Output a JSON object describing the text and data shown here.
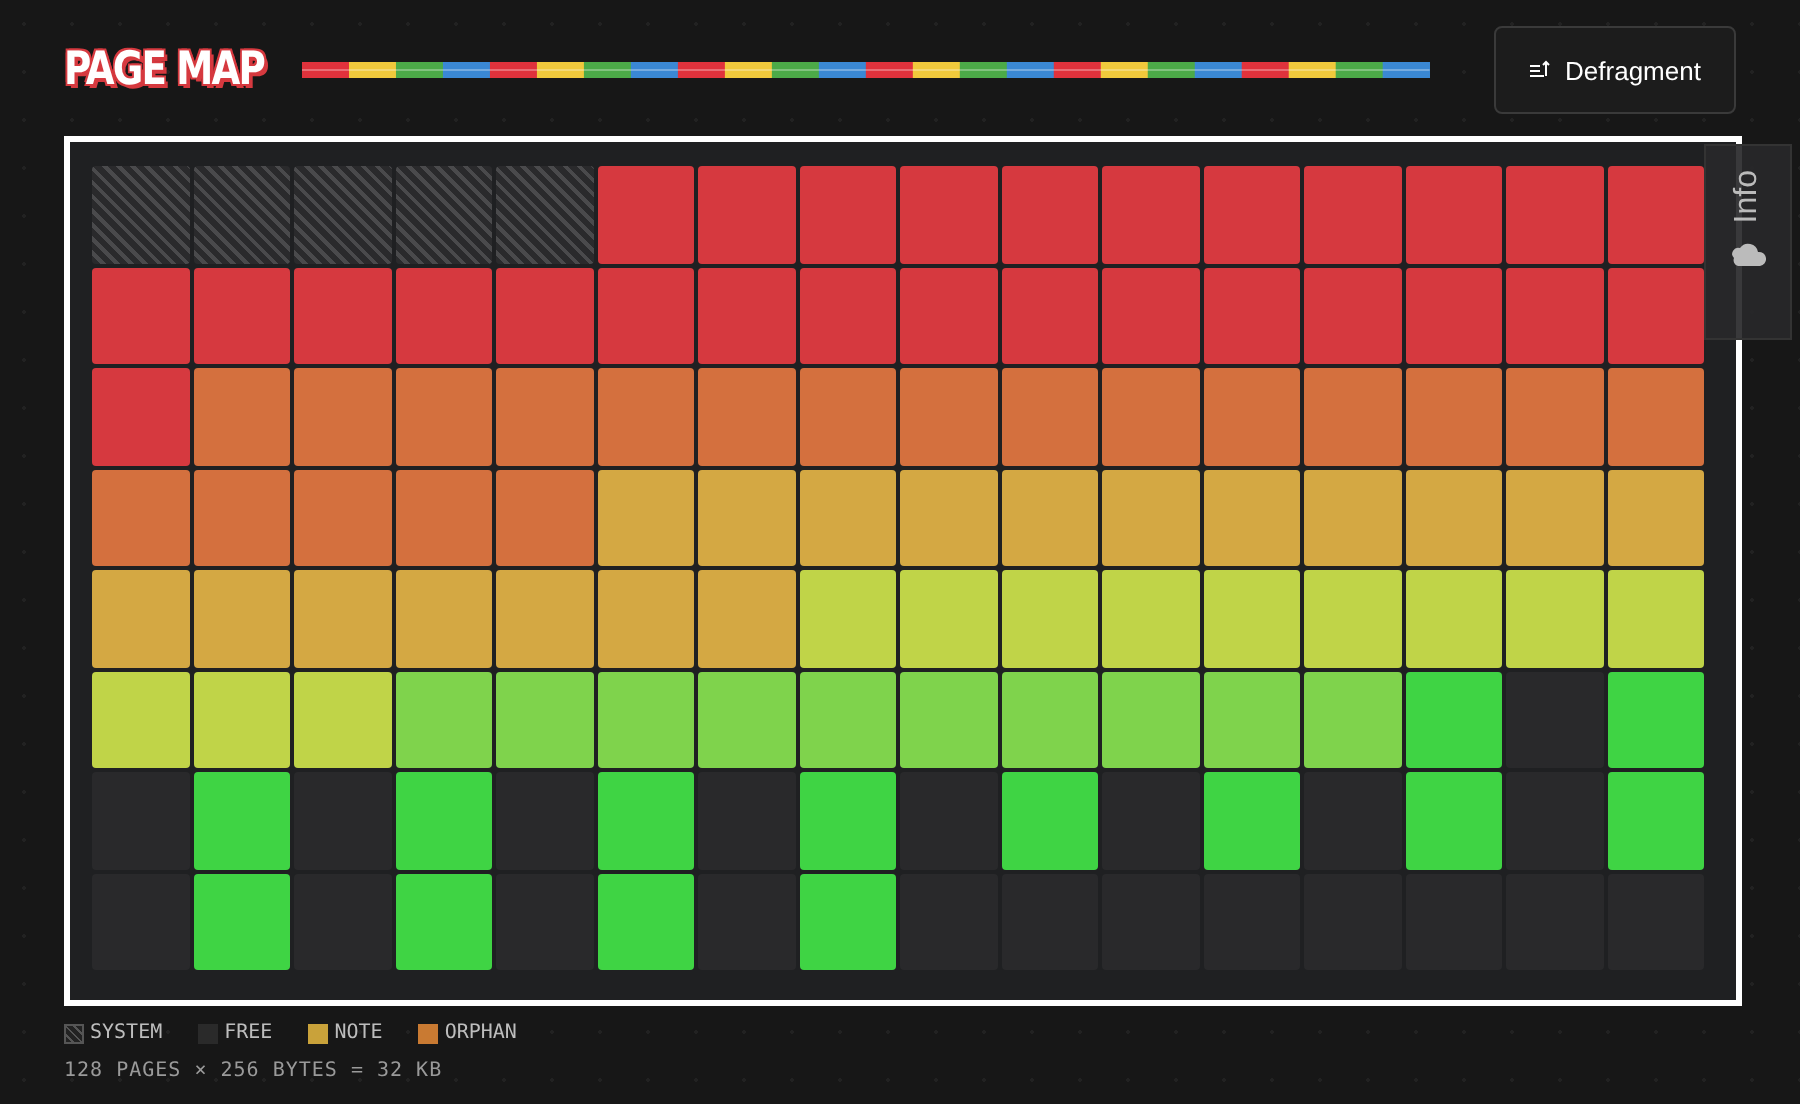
{
  "header": {
    "title": "PAGE MAP",
    "button": "Defragment"
  },
  "side_tab": {
    "label": "Info"
  },
  "pages": [
    {
      "kind": "system"
    },
    {
      "kind": "system"
    },
    {
      "kind": "system"
    },
    {
      "kind": "system"
    },
    {
      "kind": "system"
    },
    {
      "kind": "used",
      "color": "#d6393f"
    },
    {
      "kind": "used",
      "color": "#d6393f"
    },
    {
      "kind": "used",
      "color": "#d6393f"
    },
    {
      "kind": "used",
      "color": "#d6393f"
    },
    {
      "kind": "used",
      "color": "#d6393f"
    },
    {
      "kind": "used",
      "color": "#d6393f"
    },
    {
      "kind": "used",
      "color": "#d6393f"
    },
    {
      "kind": "used",
      "color": "#d6393f"
    },
    {
      "kind": "used",
      "color": "#d6393f"
    },
    {
      "kind": "used",
      "color": "#d6393f"
    },
    {
      "kind": "used",
      "color": "#d6393f"
    },
    {
      "kind": "used",
      "color": "#d6393f"
    },
    {
      "kind": "used",
      "color": "#d6393f"
    },
    {
      "kind": "used",
      "color": "#d6393f"
    },
    {
      "kind": "used",
      "color": "#d6393f"
    },
    {
      "kind": "used",
      "color": "#d6393f"
    },
    {
      "kind": "used",
      "color": "#d6393f"
    },
    {
      "kind": "used",
      "color": "#d6393f"
    },
    {
      "kind": "used",
      "color": "#d6393f"
    },
    {
      "kind": "used",
      "color": "#d6393f"
    },
    {
      "kind": "used",
      "color": "#d6393f"
    },
    {
      "kind": "used",
      "color": "#d6393f"
    },
    {
      "kind": "used",
      "color": "#d6393f"
    },
    {
      "kind": "used",
      "color": "#d6393f"
    },
    {
      "kind": "used",
      "color": "#d6393f"
    },
    {
      "kind": "used",
      "color": "#d6393f"
    },
    {
      "kind": "used",
      "color": "#d6393f"
    },
    {
      "kind": "used",
      "color": "#d6393f"
    },
    {
      "kind": "used",
      "color": "#d4703e"
    },
    {
      "kind": "used",
      "color": "#d4703e"
    },
    {
      "kind": "used",
      "color": "#d4703e"
    },
    {
      "kind": "used",
      "color": "#d4703e"
    },
    {
      "kind": "used",
      "color": "#d4703e"
    },
    {
      "kind": "used",
      "color": "#d4703e"
    },
    {
      "kind": "used",
      "color": "#d4703e"
    },
    {
      "kind": "used",
      "color": "#d4703e"
    },
    {
      "kind": "used",
      "color": "#d4703e"
    },
    {
      "kind": "used",
      "color": "#d4703e"
    },
    {
      "kind": "used",
      "color": "#d4703e"
    },
    {
      "kind": "used",
      "color": "#d4703e"
    },
    {
      "kind": "used",
      "color": "#d4703e"
    },
    {
      "kind": "used",
      "color": "#d4703e"
    },
    {
      "kind": "used",
      "color": "#d4703e"
    },
    {
      "kind": "used",
      "color": "#d4703e"
    },
    {
      "kind": "used",
      "color": "#d4703e"
    },
    {
      "kind": "used",
      "color": "#d4703e"
    },
    {
      "kind": "used",
      "color": "#d4703e"
    },
    {
      "kind": "used",
      "color": "#d4703e"
    },
    {
      "kind": "used",
      "color": "#d4a843"
    },
    {
      "kind": "used",
      "color": "#d4a843"
    },
    {
      "kind": "used",
      "color": "#d4a843"
    },
    {
      "kind": "used",
      "color": "#d4a843"
    },
    {
      "kind": "used",
      "color": "#d4a843"
    },
    {
      "kind": "used",
      "color": "#d4a843"
    },
    {
      "kind": "used",
      "color": "#d4a843"
    },
    {
      "kind": "used",
      "color": "#d4a843"
    },
    {
      "kind": "used",
      "color": "#d4a843"
    },
    {
      "kind": "used",
      "color": "#d4a843"
    },
    {
      "kind": "used",
      "color": "#d4a843"
    },
    {
      "kind": "used",
      "color": "#d4a843"
    },
    {
      "kind": "used",
      "color": "#d4a843"
    },
    {
      "kind": "used",
      "color": "#d4a843"
    },
    {
      "kind": "used",
      "color": "#d4a843"
    },
    {
      "kind": "used",
      "color": "#d4a843"
    },
    {
      "kind": "used",
      "color": "#d4a843"
    },
    {
      "kind": "used",
      "color": "#d4a843"
    },
    {
      "kind": "used",
      "color": "#c0d448"
    },
    {
      "kind": "used",
      "color": "#c0d448"
    },
    {
      "kind": "used",
      "color": "#c0d448"
    },
    {
      "kind": "used",
      "color": "#c0d448"
    },
    {
      "kind": "used",
      "color": "#c0d448"
    },
    {
      "kind": "used",
      "color": "#c0d448"
    },
    {
      "kind": "used",
      "color": "#c0d448"
    },
    {
      "kind": "used",
      "color": "#c0d448"
    },
    {
      "kind": "used",
      "color": "#c0d448"
    },
    {
      "kind": "used",
      "color": "#c0d448"
    },
    {
      "kind": "used",
      "color": "#c0d448"
    },
    {
      "kind": "used",
      "color": "#c0d448"
    },
    {
      "kind": "used",
      "color": "#7fd34c"
    },
    {
      "kind": "used",
      "color": "#7fd34c"
    },
    {
      "kind": "used",
      "color": "#7fd34c"
    },
    {
      "kind": "used",
      "color": "#7fd34c"
    },
    {
      "kind": "used",
      "color": "#7fd34c"
    },
    {
      "kind": "used",
      "color": "#7fd34c"
    },
    {
      "kind": "used",
      "color": "#7fd34c"
    },
    {
      "kind": "used",
      "color": "#7fd34c"
    },
    {
      "kind": "used",
      "color": "#7fd34c"
    },
    {
      "kind": "used",
      "color": "#7fd34c"
    },
    {
      "kind": "used",
      "color": "#3fd444"
    },
    {
      "kind": "free"
    },
    {
      "kind": "used",
      "color": "#3fd444"
    },
    {
      "kind": "free"
    },
    {
      "kind": "used",
      "color": "#3fd444"
    },
    {
      "kind": "free"
    },
    {
      "kind": "used",
      "color": "#3fd444"
    },
    {
      "kind": "free"
    },
    {
      "kind": "used",
      "color": "#3fd444"
    },
    {
      "kind": "free"
    },
    {
      "kind": "used",
      "color": "#3fd444"
    },
    {
      "kind": "free"
    },
    {
      "kind": "used",
      "color": "#3fd444"
    },
    {
      "kind": "free"
    },
    {
      "kind": "used",
      "color": "#3fd444"
    },
    {
      "kind": "free"
    },
    {
      "kind": "used",
      "color": "#3fd444"
    },
    {
      "kind": "free"
    },
    {
      "kind": "used",
      "color": "#3fd444"
    },
    {
      "kind": "free"
    },
    {
      "kind": "used",
      "color": "#3fd444"
    },
    {
      "kind": "free"
    },
    {
      "kind": "used",
      "color": "#3fd444"
    },
    {
      "kind": "free"
    },
    {
      "kind": "used",
      "color": "#3fd444"
    },
    {
      "kind": "free"
    },
    {
      "kind": "used",
      "color": "#3fd444"
    },
    {
      "kind": "free"
    },
    {
      "kind": "free"
    },
    {
      "kind": "free"
    },
    {
      "kind": "free"
    },
    {
      "kind": "free"
    },
    {
      "kind": "free"
    },
    {
      "kind": "free"
    },
    {
      "kind": "free"
    }
  ],
  "legend": [
    {
      "label": "SYSTEM",
      "kind": "system"
    },
    {
      "label": "FREE",
      "kind": "free"
    },
    {
      "label": "NOTE",
      "kind": "solid",
      "color": "#c9a23a"
    },
    {
      "label": "ORPHAN",
      "kind": "solid",
      "color": "#c97a32"
    }
  ],
  "summary": "128 PAGES × 256 BYTES = 32 KB"
}
